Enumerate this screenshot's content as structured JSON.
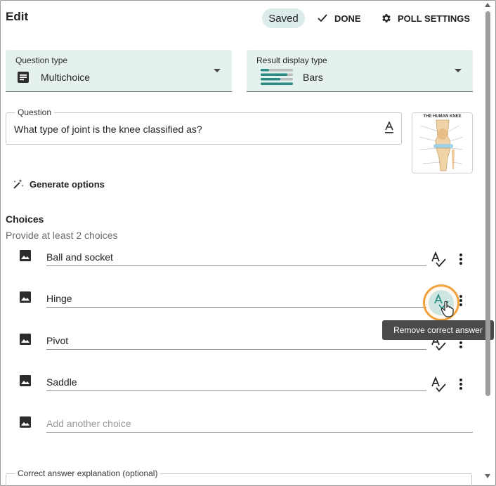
{
  "header": {
    "title": "Edit",
    "saved_label": "Saved",
    "done_label": "DONE",
    "poll_settings_label": "POLL SETTINGS"
  },
  "question_type": {
    "label": "Question type",
    "value": "Multichoice"
  },
  "result_display": {
    "label": "Result display type",
    "value": "Bars"
  },
  "question": {
    "legend": "Question",
    "text": "What type of joint is the knee classified as?",
    "image_title": "THE HUMAN KNEE"
  },
  "generate_options_label": "Generate options",
  "choices": {
    "heading": "Choices",
    "hint": "Provide at least 2 choices",
    "items": [
      {
        "label": "Ball and socket"
      },
      {
        "label": "Hinge"
      },
      {
        "label": "Pivot"
      },
      {
        "label": "Saddle"
      }
    ],
    "add_placeholder": "Add another choice"
  },
  "tooltip": "Remove correct answer",
  "explanation_legend": "Correct answer explanation (optional)",
  "colors": {
    "accent_teal": "#2a8c84",
    "select_bg": "#e4f1ef",
    "highlight_orange": "#f0a23c"
  }
}
